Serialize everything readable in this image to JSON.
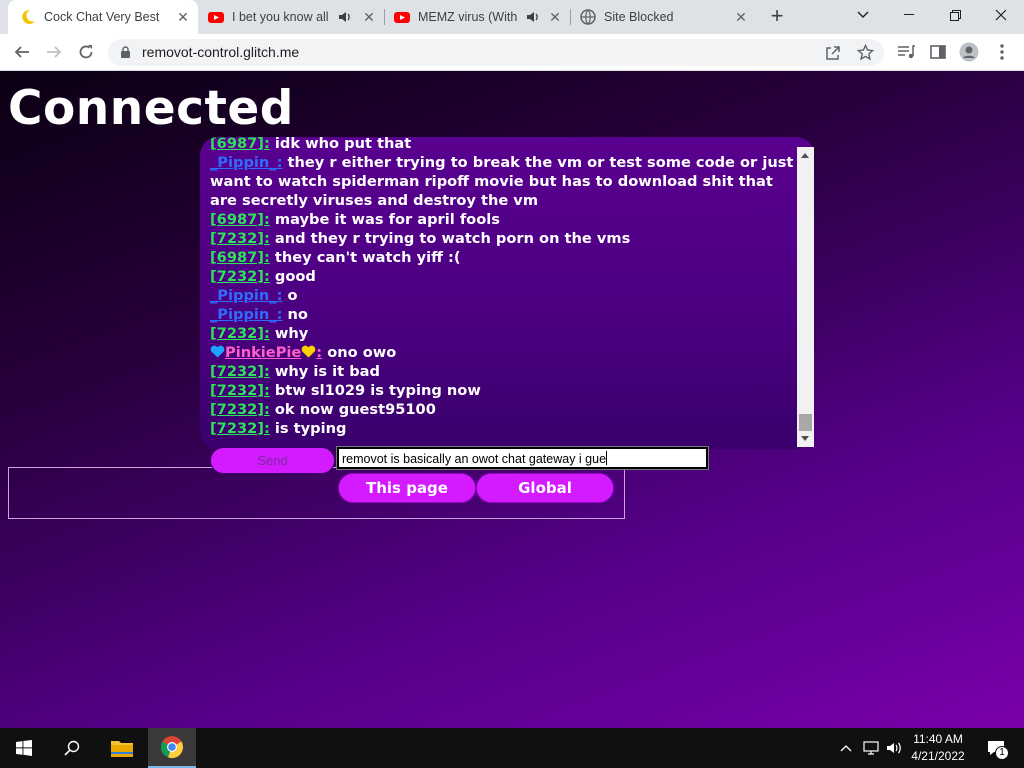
{
  "browser": {
    "tabs": [
      {
        "title": "Cock Chat Very Best",
        "favicon": "moon-icon",
        "active": true
      },
      {
        "title": "I bet you know all",
        "favicon": "youtube-icon",
        "audio": true
      },
      {
        "title": "MEMZ virus (With",
        "favicon": "youtube-icon",
        "audio": true
      },
      {
        "title": "Site Blocked",
        "favicon": "globe-icon"
      }
    ],
    "address": "removot-control.glitch.me"
  },
  "page": {
    "heading": "Connected",
    "messages": [
      {
        "user": "[6987]",
        "color": "#2ce35a",
        "text": "idk who put that"
      },
      {
        "user": "_Pippin_",
        "color": "#2f6bff",
        "text": "they r either trying to break the vm or test some code or just want to watch spiderman ripoff movie but has to download shit that are secretly viruses and destroy the vm"
      },
      {
        "user": "[6987]",
        "color": "#2ce35a",
        "text": "maybe it was for april fools"
      },
      {
        "user": "[7232]",
        "color": "#2ce35a",
        "text": "and they r trying to watch porn on the vms"
      },
      {
        "user": "[6987]",
        "color": "#2ce35a",
        "text": "they can't watch yiff :("
      },
      {
        "user": "[7232]",
        "color": "#2ce35a",
        "text": "good"
      },
      {
        "user": "_Pippin_",
        "color": "#2f6bff",
        "text": "o"
      },
      {
        "user": "_Pippin_",
        "color": "#2f6bff",
        "text": "no"
      },
      {
        "user": "[7232]",
        "color": "#2ce35a",
        "text": "why"
      },
      {
        "user": "PinkiePie",
        "color": "#ff5fc8",
        "text": "ono owo",
        "hearts": [
          "#1ea0ff",
          "#ffd000"
        ]
      },
      {
        "user": "[7232]",
        "color": "#2ce35a",
        "text": "why is it bad"
      },
      {
        "user": "[7232]",
        "color": "#2ce35a",
        "text": "btw sl1029 is typing now"
      },
      {
        "user": "[7232]",
        "color": "#2ce35a",
        "text": "ok now guest95100"
      },
      {
        "user": "[7232]",
        "color": "#2ce35a",
        "text": "is typing"
      }
    ],
    "send_label": "Send",
    "input_value": "removot is basically an owot chat gateway i gue",
    "this_page_label": "This page",
    "global_label": "Global"
  },
  "taskbar": {
    "time": "11:40 AM",
    "date": "4/21/2022",
    "notification_count": "1"
  }
}
